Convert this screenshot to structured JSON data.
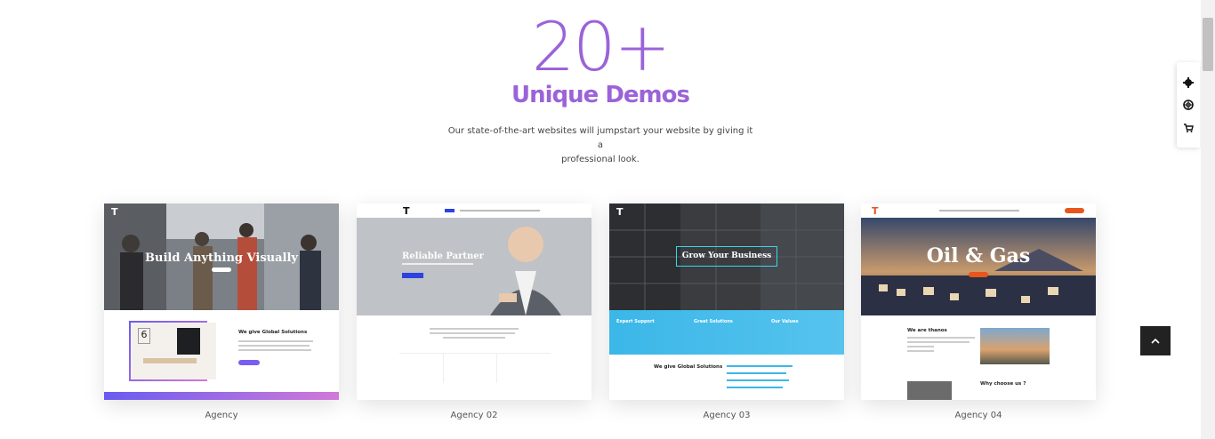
{
  "hero": {
    "count": "20+",
    "title": "Unique Demos",
    "description_line1": "Our state-of-the-art websites will jumpstart your website by giving it a",
    "description_line2": "professional look."
  },
  "demos": [
    {
      "caption": "Agency",
      "hero_title": "Build Anything Visually",
      "section_title": "We give Global Solutions"
    },
    {
      "caption": "Agency 02",
      "hero_title": "Reliable Partner"
    },
    {
      "caption": "Agency 03",
      "hero_title": "Grow Your Business",
      "col1": "Expert Support",
      "col2": "Great Solutions",
      "col3": "Our Values",
      "section_title": "We give Global Solutions"
    },
    {
      "caption": "Agency 04",
      "hero_title": "Oil & Gas",
      "section_title": "We are thanos",
      "section_title2": "Why choose us ?"
    }
  ],
  "widget_icons": [
    "gear-icon",
    "lifebuoy-icon",
    "cart-icon"
  ],
  "colors": {
    "accent": "#9b63d8",
    "brand_orange": "#e8561f",
    "blue": "#2d42e0",
    "cyan": "#3bb7e8"
  }
}
